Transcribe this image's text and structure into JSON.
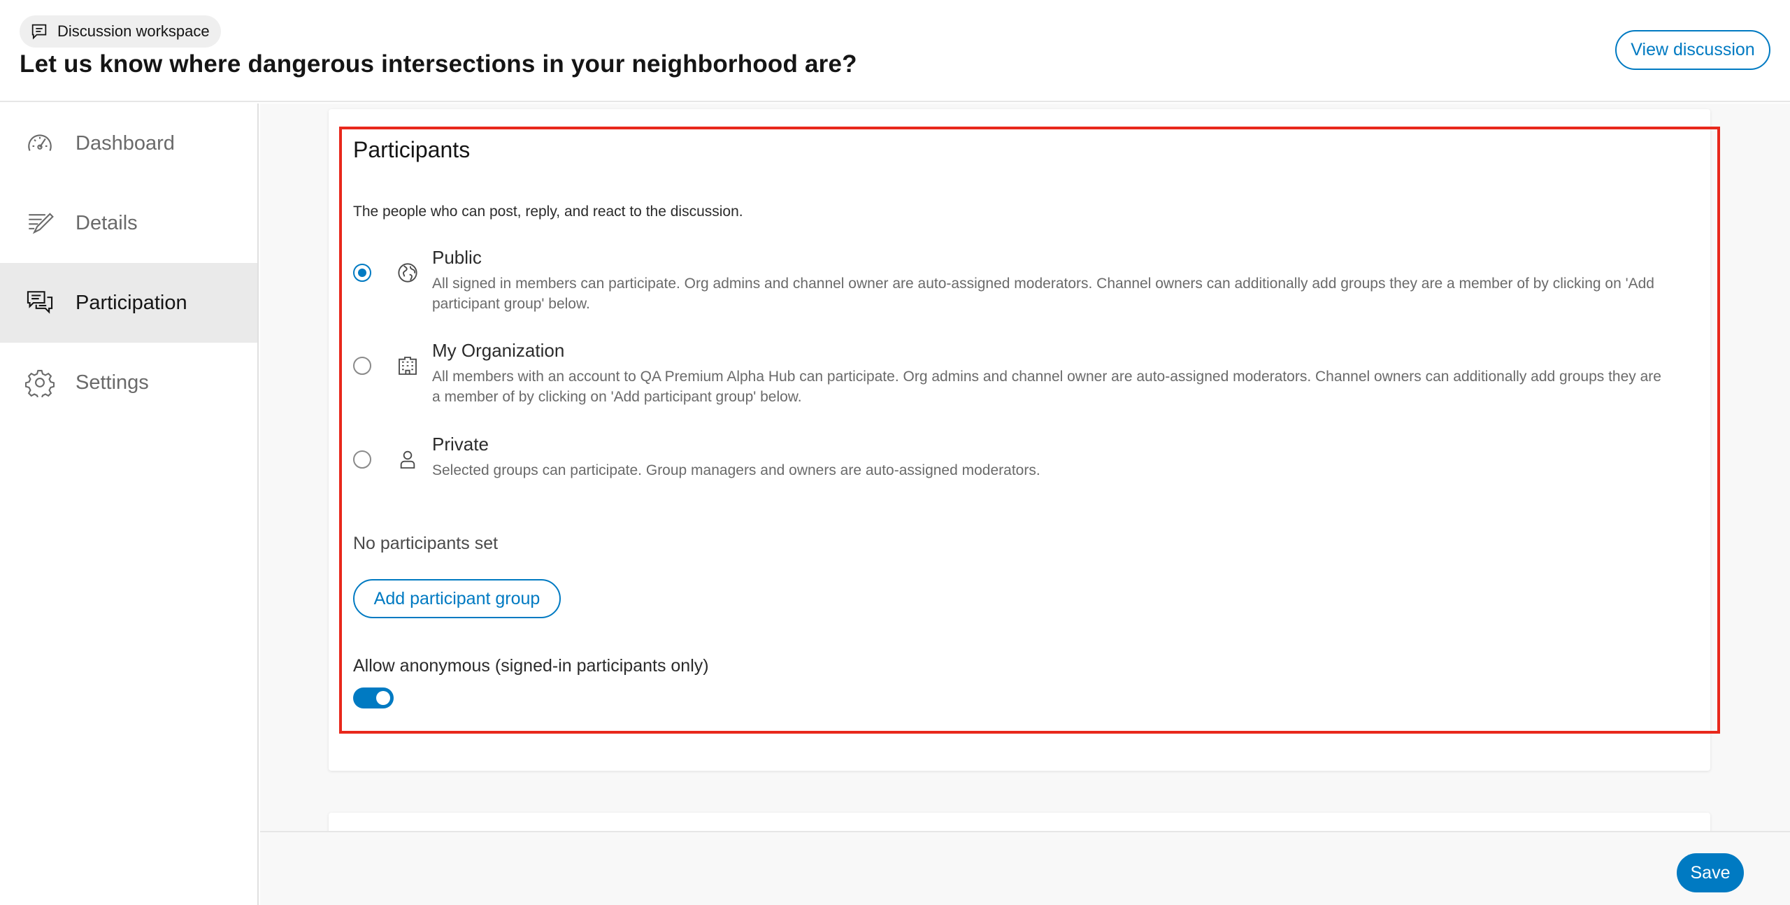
{
  "header": {
    "workspace_label": "Discussion workspace",
    "title": "Let us know where dangerous intersections in your neighborhood are?",
    "view_button": "View discussion"
  },
  "sidebar": {
    "items": [
      {
        "label": "Dashboard",
        "icon": "dashboard-icon",
        "active": false
      },
      {
        "label": "Details",
        "icon": "details-icon",
        "active": false
      },
      {
        "label": "Participation",
        "icon": "participation-icon",
        "active": true
      },
      {
        "label": "Settings",
        "icon": "gear-icon",
        "active": false
      }
    ]
  },
  "participants": {
    "title": "Participants",
    "description": "The people who can post, reply, and react to the discussion.",
    "options": [
      {
        "title": "Public",
        "description": "All signed in members can participate. Org admins and channel owner are auto-assigned moderators. Channel owners can additionally add groups they are a member of by clicking on 'Add participant group' below.",
        "icon": "globe-icon",
        "selected": true
      },
      {
        "title": "My Organization",
        "description": "All members with an account to QA Premium Alpha Hub can participate. Org admins and channel owner are auto-assigned moderators. Channel owners can additionally add groups they are a member of by clicking on 'Add participant group' below.",
        "icon": "organization-icon",
        "selected": false
      },
      {
        "title": "Private",
        "description": "Selected groups can participate. Group managers and owners are auto-assigned moderators.",
        "icon": "user-icon",
        "selected": false
      }
    ],
    "no_participants": "No participants set",
    "add_group_button": "Add participant group",
    "anonymous_label": "Allow anonymous (signed-in participants only)",
    "anonymous_enabled": true
  },
  "footer": {
    "save_button": "Save"
  },
  "colors": {
    "accent": "#007ac2",
    "highlight": "#e8281c"
  }
}
